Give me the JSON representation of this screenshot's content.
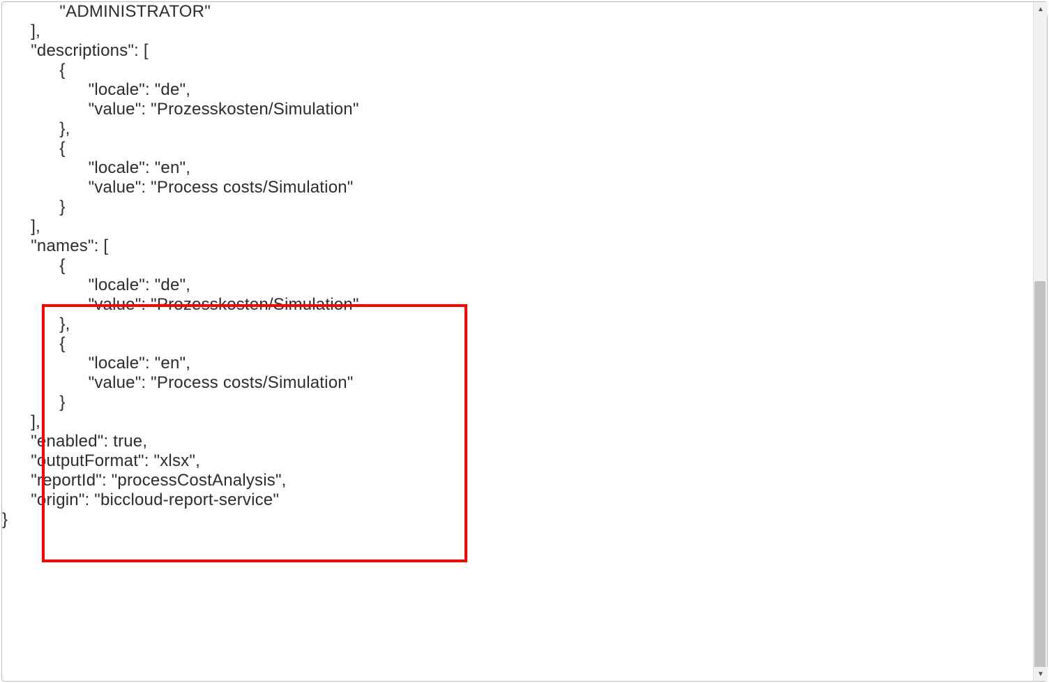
{
  "code": {
    "line1": "            \"ADMINISTRATOR\"",
    "line2": "      ],",
    "line3": "      \"descriptions\": [",
    "line4": "            {",
    "line5": "                  \"locale\": \"de\",",
    "line6": "                  \"value\": \"Prozesskosten/Simulation\"",
    "line7": "            },",
    "line8": "            {",
    "line9": "                  \"locale\": \"en\",",
    "line10": "                  \"value\": \"Process costs/Simulation\"",
    "line11": "            }",
    "line12": "      ],",
    "line13": "      \"names\": [",
    "line14": "            {",
    "line15": "                  \"locale\": \"de\",",
    "line16": "                  \"value\": \"Prozesskosten/Simulation\"",
    "line17": "            },",
    "line18": "            {",
    "line19": "                  \"locale\": \"en\",",
    "line20": "                  \"value\": \"Process costs/Simulation\"",
    "line21": "            }",
    "line22": "      ],",
    "line23": "      \"enabled\": true,",
    "line24": "      \"outputFormat\": \"xlsx\",",
    "line25": "      \"reportId\": \"processCostAnalysis\",",
    "line26": "      \"origin\": \"biccloud-report-service\"",
    "line27": "}"
  },
  "scrollbar": {
    "up_glyph": "▲",
    "down_glyph": "▼"
  }
}
